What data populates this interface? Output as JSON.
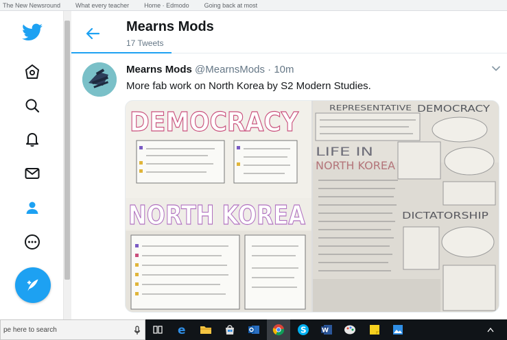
{
  "browser": {
    "bookmarks": [
      "The New Newsround",
      "What every teacher",
      "Home · Edmodo",
      "Going back at most"
    ]
  },
  "nav": {
    "icons": [
      "twitter-logo-icon",
      "home-icon",
      "explore-icon",
      "notifications-icon",
      "messages-icon",
      "profile-icon",
      "more-icon",
      "compose-tweet-icon"
    ],
    "active_item": "profile",
    "accent_color": "#1da1f2"
  },
  "header": {
    "title": "Mearns Mods",
    "subtitle": "17 Tweets"
  },
  "tweet": {
    "name": "Mearns Mods",
    "handle": "@MearnsMods",
    "separator": "·",
    "time": "10m",
    "text": "More fab work on North Korea by S2 Modern Studies.",
    "media": {
      "left_poster": {
        "heading_top": "DEMOCRACY",
        "heading_bottom": "NORTH KOREA"
      },
      "right_poster": {
        "heading_top_left": "REPRESENTATIVE",
        "heading_top_right": "DEMOCRACY",
        "heading_middle_line1": "LIFE IN",
        "heading_middle_line2": "NORTH KOREA",
        "heading_bottom": "DICTATORSHIP"
      }
    }
  },
  "taskbar": {
    "search_placeholder": "pe here to search",
    "icons": [
      "task-view-icon",
      "edge-icon",
      "file-explorer-icon",
      "store-icon",
      "outlook-icon",
      "chrome-icon",
      "skype-icon",
      "word-icon",
      "paint-icon",
      "sticky-notes-icon",
      "photos-icon"
    ],
    "active_app": "chrome"
  }
}
